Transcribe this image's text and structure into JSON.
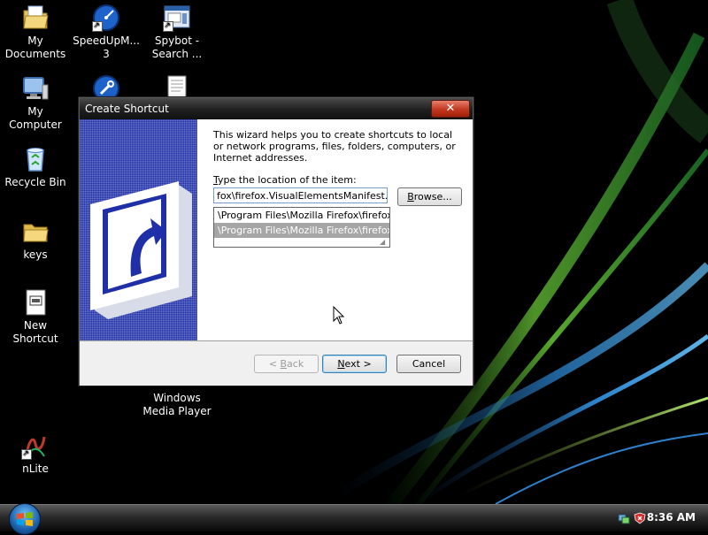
{
  "desktop": {
    "icons": [
      {
        "label": "My Documents",
        "icon": "my-documents-icon"
      },
      {
        "label": "SpeedUpM... 3",
        "icon": "speedometer-icon"
      },
      {
        "label": "Spybot - Search ...",
        "icon": "spybot-icon"
      },
      {
        "label": "My Computer",
        "icon": "computer-icon"
      },
      {
        "label": "Recycle Bin",
        "icon": "recycle-bin-icon"
      },
      {
        "label": "keys",
        "icon": "folder-icon"
      },
      {
        "label": "New Shortcut",
        "icon": "shortcut-file-icon"
      },
      {
        "label": "Windows Media Player",
        "icon": "media-player-icon"
      },
      {
        "label": "nLite",
        "icon": "nlite-icon"
      }
    ]
  },
  "dialog": {
    "title": "Create Shortcut",
    "close_label": "✕",
    "intro": "This wizard helps you to create shortcuts to local or network programs, files, folders, computers, or Internet addresses.",
    "location_label_first": "T",
    "location_label_rest": "ype the location of the item:",
    "location_value": "fox\\firefox.VisualElementsManifest.xml",
    "browse_first": "B",
    "browse_rest": "rowse...",
    "suggestions": [
      "\\Program Files\\Mozilla Firefox\\firefox",
      "\\Program Files\\Mozilla Firefox\\firefox"
    ],
    "suggestion_selected_index": 1,
    "back_label_pre": "< ",
    "back_label_u": "B",
    "back_label_post": "ack",
    "next_label_u": "N",
    "next_label_post": "ext >",
    "cancel_label": "Cancel"
  },
  "taskbar": {
    "time": "8:36 AM",
    "start_icon": "windows-logo-icon",
    "tray_icons": [
      "network-icon",
      "security-shield-icon"
    ]
  },
  "colors": {
    "accent": "#1e2fa8",
    "close": "#c1371f",
    "selection": "#a6a6a6"
  }
}
